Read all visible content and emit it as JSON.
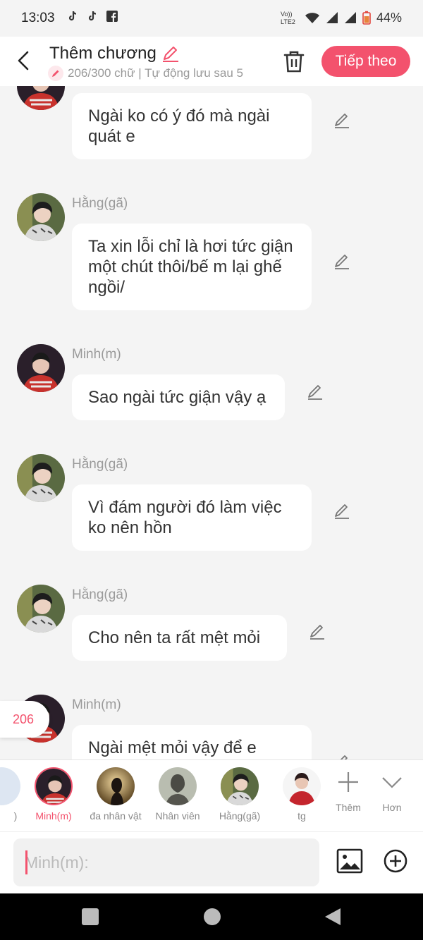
{
  "status": {
    "time": "13:03",
    "battery": "44%",
    "network": "Vo)) LTE2"
  },
  "header": {
    "title": "Thêm chương",
    "subtitle": "206/300 chữ | Tự động lưu sau 5",
    "next_label": "Tiếp theo"
  },
  "messages": [
    {
      "author": "",
      "text": "Ngài ko có ý đó mà ngài quát e",
      "avatar": "minh"
    },
    {
      "author": "Hằng(gã)",
      "text": "Ta xin lỗi chỉ là hơi tức giận một chút thôi/bế m lại ghế ngồi/",
      "avatar": "hang"
    },
    {
      "author": "Minh(m)",
      "text": "Sao ngài tức giận vậy ạ",
      "avatar": "minh"
    },
    {
      "author": "Hằng(gã)",
      "text": "Vì đám người đó làm việc ko nên hồn",
      "avatar": "hang"
    },
    {
      "author": "Hằng(gã)",
      "text": "Cho nên ta rất mệt mỏi",
      "avatar": "hang"
    },
    {
      "author": "Minh(m)",
      "text": "Ngài mệt mỏi vậy để e",
      "avatar": "minh"
    }
  ],
  "word_count_badge": "206",
  "characters": [
    {
      "name": ")",
      "selected": false
    },
    {
      "name": "Minh(m)",
      "selected": true
    },
    {
      "name": "đa nhân vật",
      "selected": false
    },
    {
      "name": "Nhân viên",
      "selected": false
    },
    {
      "name": "Hằng(gã)",
      "selected": false
    },
    {
      "name": "tg",
      "selected": false
    }
  ],
  "tools": {
    "add_label": "Thêm",
    "more_label": "Hơn"
  },
  "input": {
    "placeholder": "Minh(m):"
  },
  "colors": {
    "accent": "#f3526d",
    "background": "#f4f4f4"
  }
}
